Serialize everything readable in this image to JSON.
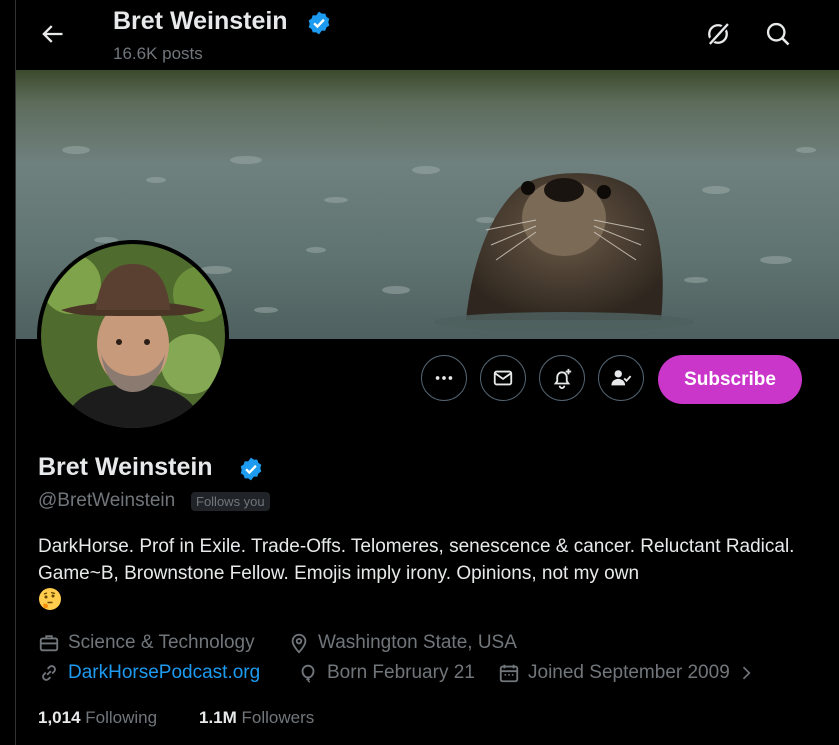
{
  "header": {
    "display_name": "Bret Weinstein",
    "posts_count": "16.6K posts"
  },
  "profile": {
    "display_name": "Bret Weinstein",
    "handle": "@BretWeinstein",
    "follows_you": "Follows you",
    "bio": "DarkHorse. Prof in Exile. Trade-Offs. Telomeres, senescence & cancer. Reluctant Radical. Game~B, Brownstone Fellow. Emojis imply irony. Opinions, not my own",
    "bio_emoji": "thinking-face-icon",
    "category": "Science & Technology",
    "location": "Washington State, USA",
    "website": "DarkHorsePodcast.org",
    "birthday": "Born February 21",
    "joined": "Joined September 2009",
    "following_count": "1,014",
    "following_label": "Following",
    "followers_count": "1.1M",
    "followers_label": "Followers"
  },
  "actions": {
    "subscribe_label": "Subscribe",
    "more_icon": "more-icon",
    "message_icon": "envelope-icon",
    "notify_icon": "bell-plus-icon",
    "following_icon": "user-check-icon"
  },
  "colors": {
    "background": "#000000",
    "subscribe": "#c936c9",
    "link": "#1d9bf0",
    "verified": "#1d9bf0",
    "muted": "#71767b"
  }
}
